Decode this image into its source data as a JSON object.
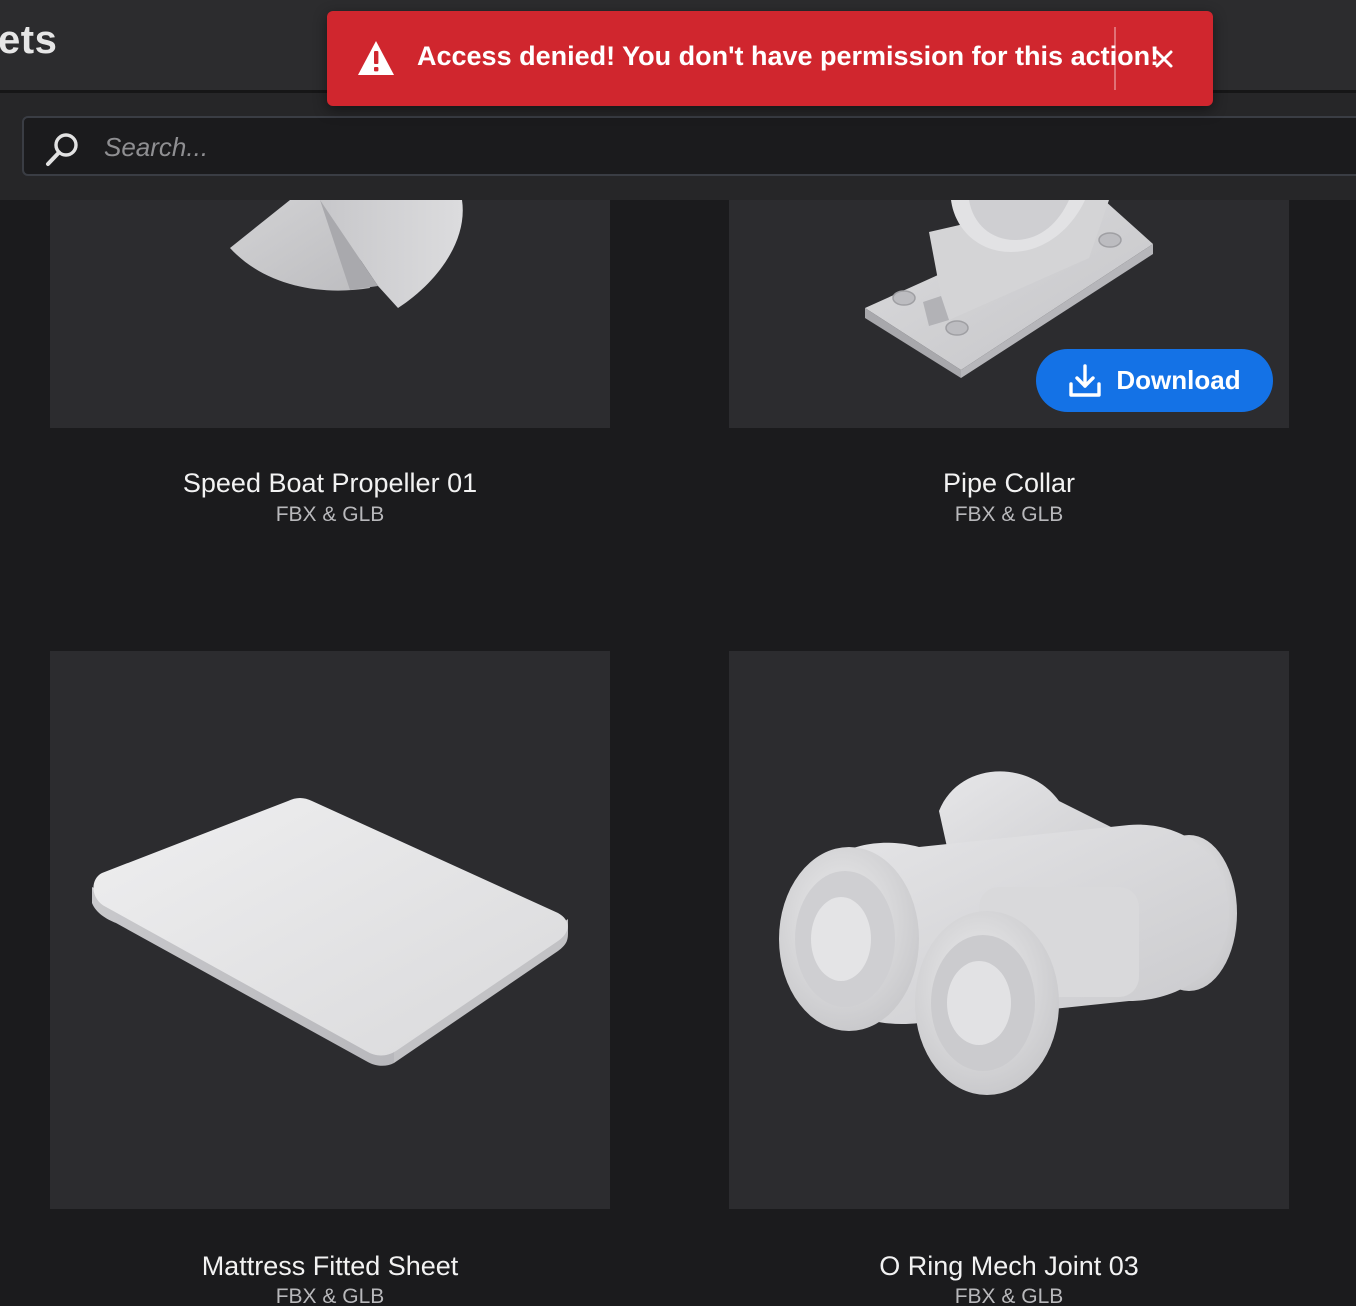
{
  "header": {
    "title": "ets"
  },
  "search": {
    "placeholder": "Search..."
  },
  "toast": {
    "message": "Access denied! You don't have permission for this action!",
    "close_label": "×"
  },
  "assets": [
    {
      "title": "Speed Boat Propeller 01",
      "format": "FBX & GLB"
    },
    {
      "title": "Pipe Collar",
      "format": "FBX & GLB",
      "action_label": "Download"
    },
    {
      "title": "Mattress Fitted Sheet",
      "format": "FBX & GLB"
    },
    {
      "title": "O Ring Mech Joint 03",
      "format": "FBX & GLB"
    }
  ],
  "colors": {
    "toast_bg": "#d0262e",
    "download_bg": "#1472e6",
    "page_bg": "#1b1b1d",
    "card_bg": "#2c2c2f"
  },
  "icons": {
    "search": "search-icon",
    "warning": "warning-icon",
    "close": "close-icon",
    "download": "download-icon"
  }
}
